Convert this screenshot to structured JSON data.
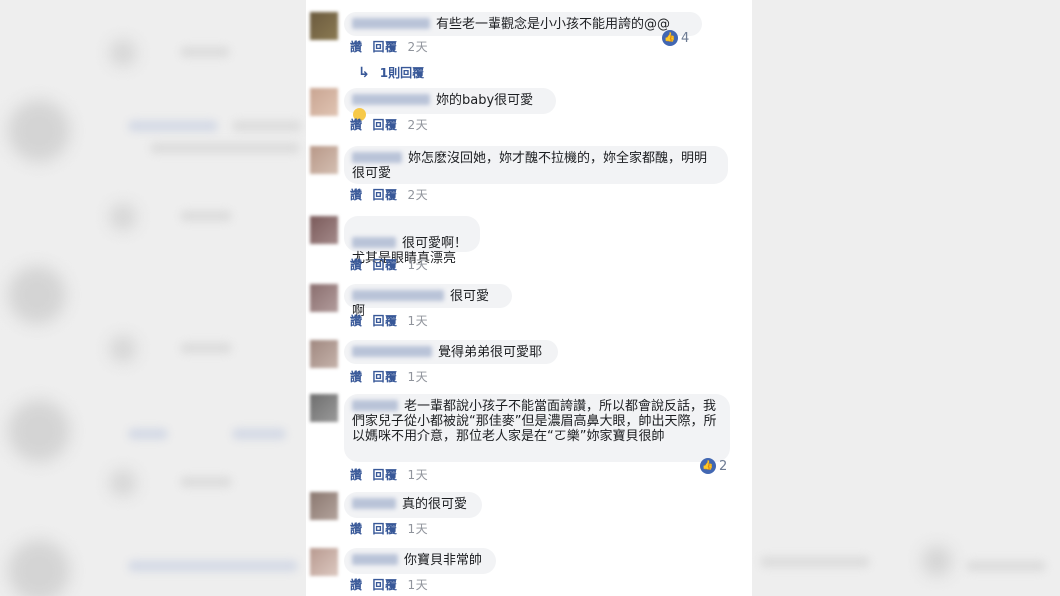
{
  "actions": {
    "like": "讚",
    "reply": "回覆"
  },
  "emoji": "emoji-face",
  "colors": {
    "link": "#385898",
    "bubble": "#f2f3f5",
    "like_badge": "#4267b2",
    "timestamp": "#90949c"
  },
  "comments": [
    {
      "text": "有些老一輩觀念是小小孩不能用誇的@@",
      "time": "2天",
      "reactions": "4",
      "replies_link": "1則回覆"
    },
    {
      "text": "妳的baby很可愛",
      "time": "2天"
    },
    {
      "text": "妳怎麽沒回她，妳才醜不拉機的，妳全家都醜，明明很可愛",
      "time": "2天"
    },
    {
      "text": "很可愛啊！\n尤其是眼睛真漂亮",
      "time": "1天"
    },
    {
      "text": "很可愛啊",
      "time": "1天"
    },
    {
      "text": "覺得弟弟很可愛耶",
      "time": "1天"
    },
    {
      "text": "老一輩都說小孩子不能當面誇讚，所以都會說反話，我們家兒子從小都被說“那佳麥”但是濃眉高鼻大眼，帥出天際，所以媽咪不用介意，那位老人家是在“ㄛ樂”妳家寶貝很帥",
      "time": "1天",
      "reactions": "2"
    },
    {
      "text": "真的很可愛",
      "time": "1天"
    },
    {
      "text": "你寶貝非常帥",
      "time": "1天"
    }
  ]
}
